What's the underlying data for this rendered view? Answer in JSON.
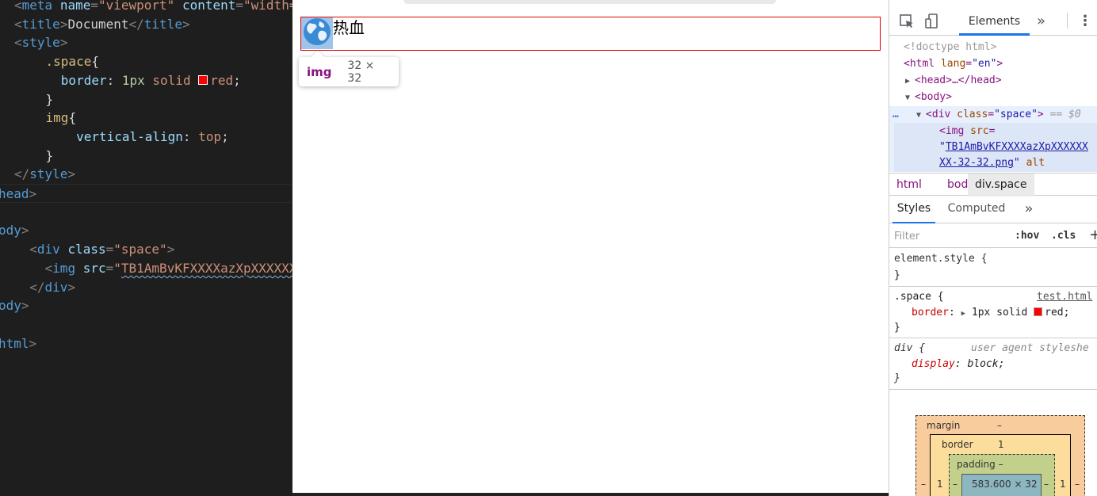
{
  "editor": {
    "lines": [
      {
        "parts": [
          [
            "p",
            "<"
          ],
          [
            "t",
            "meta "
          ],
          [
            "a",
            "name"
          ],
          [
            "p",
            "="
          ],
          [
            "s",
            "\"viewport\""
          ],
          [
            "x",
            " "
          ],
          [
            "a",
            "content"
          ],
          [
            "p",
            "="
          ],
          [
            "s",
            "\"width="
          ]
        ]
      },
      {
        "parts": [
          [
            "p",
            "<"
          ],
          [
            "t",
            "title"
          ],
          [
            "p",
            ">"
          ],
          [
            "x",
            "Document"
          ],
          [
            "p",
            "</"
          ],
          [
            "t",
            "title"
          ],
          [
            "p",
            ">"
          ]
        ]
      },
      {
        "parts": [
          [
            "p",
            "<"
          ],
          [
            "t",
            "style"
          ],
          [
            "p",
            ">"
          ]
        ]
      },
      {
        "parts": [
          [
            "x",
            "    "
          ],
          [
            "sel",
            ".space"
          ],
          [
            "x",
            "{"
          ]
        ]
      },
      {
        "parts": [
          [
            "x",
            "      "
          ],
          [
            "pr",
            "border"
          ],
          [
            "x",
            ": "
          ],
          [
            "n",
            "1px"
          ],
          [
            "x",
            " "
          ],
          [
            "v",
            "solid "
          ],
          [
            "sw",
            ""
          ],
          [
            "v",
            "red"
          ],
          [
            "x",
            ";"
          ]
        ]
      },
      {
        "parts": [
          [
            "x",
            "    }"
          ]
        ]
      },
      {
        "parts": [
          [
            "x",
            "    "
          ],
          [
            "sel",
            "img"
          ],
          [
            "x",
            "{"
          ]
        ]
      },
      {
        "parts": [
          [
            "x",
            "        "
          ],
          [
            "pr",
            "vertical-align"
          ],
          [
            "x",
            ": "
          ],
          [
            "v",
            "top"
          ],
          [
            "x",
            ";"
          ]
        ]
      },
      {
        "parts": [
          [
            "x",
            "    }"
          ]
        ]
      },
      {
        "parts": [
          [
            "p",
            "</"
          ],
          [
            "t",
            "style"
          ],
          [
            "p",
            ">"
          ]
        ]
      },
      {
        "parts": [
          [
            "t",
            "head"
          ],
          [
            "p",
            ">"
          ]
        ]
      },
      {
        "parts": [
          [
            "x",
            ""
          ]
        ]
      },
      {
        "parts": [
          [
            "t",
            "ody"
          ],
          [
            "p",
            ">"
          ]
        ]
      },
      {
        "parts": [
          [
            "x",
            "  "
          ],
          [
            "p",
            "<"
          ],
          [
            "t",
            "div "
          ],
          [
            "a",
            "class"
          ],
          [
            "p",
            "="
          ],
          [
            "s",
            "\"space\""
          ],
          [
            "p",
            ">"
          ]
        ]
      },
      {
        "parts": [
          [
            "x",
            "    "
          ],
          [
            "p",
            "<"
          ],
          [
            "t",
            "img "
          ],
          [
            "a",
            "src"
          ],
          [
            "p",
            "="
          ],
          [
            "s",
            "\""
          ],
          [
            "l",
            "TB1AmBvKFXXXXazXpXXXXXX"
          ]
        ]
      },
      {
        "parts": [
          [
            "x",
            "  "
          ],
          [
            "p",
            "</"
          ],
          [
            "t",
            "div"
          ],
          [
            "p",
            ">"
          ]
        ]
      },
      {
        "parts": [
          [
            "t",
            "ody"
          ],
          [
            "p",
            ">"
          ]
        ]
      },
      {
        "parts": [
          [
            "x",
            ""
          ]
        ]
      },
      {
        "parts": [
          [
            "t",
            "html"
          ],
          [
            "p",
            ">"
          ]
        ]
      }
    ]
  },
  "page": {
    "hero_text": "热血",
    "tooltip": {
      "tag": "img",
      "size": "32 × 32"
    }
  },
  "devtools": {
    "tab_elements": "Elements",
    "more_tabs": "»",
    "menu": "⋮",
    "dom": {
      "doctype": "<!doctype html>",
      "html_open_tag": "<html",
      "html_lang_attr": "lang",
      "html_lang_val": "\"en\"",
      "head_collapsed": "<head>…</head>",
      "body_open": "<body>",
      "div_tag": "<div",
      "div_class_attr": "class",
      "div_class_val": "\"space\"",
      "div_close_bracket": ">",
      "selected_marker": "== $0",
      "dots": "…",
      "img_tag": "<img",
      "img_src_attr": "src",
      "img_src_val_1": "TB1AmBvKFXXXXazXpXXXXXX",
      "img_src_val_2": "XX-32-32.png",
      "img_alt_attr": "alt"
    },
    "breadcrumbs": [
      "html",
      "body",
      "div.space"
    ],
    "sub_tabs": {
      "styles": "Styles",
      "computed": "Computed",
      "more": "»"
    },
    "filter": {
      "placeholder": "Filter",
      "hov": ":hov",
      "cls": ".cls",
      "plus": "+"
    },
    "rules": {
      "element_style": "element.style {",
      "close_brace": "}",
      "space_selector": ".space {",
      "space_source": "test.html",
      "border_prop": "border",
      "border_value_pre": "1px solid",
      "border_value_color": "red;",
      "div_selector": "div {",
      "ua_label": "user agent styleshe",
      "display_prop": "display",
      "display_value": "block;"
    },
    "box_model": {
      "margin_label": "margin",
      "margin_top": "–",
      "border_label": "border",
      "border_top": "1",
      "padding_label": "padding –",
      "content_size": "583.600 × 32",
      "side_dash": "–",
      "side_one": "1"
    },
    "colors": {
      "accent": "#1a73e8",
      "red": "#ff0000"
    }
  }
}
